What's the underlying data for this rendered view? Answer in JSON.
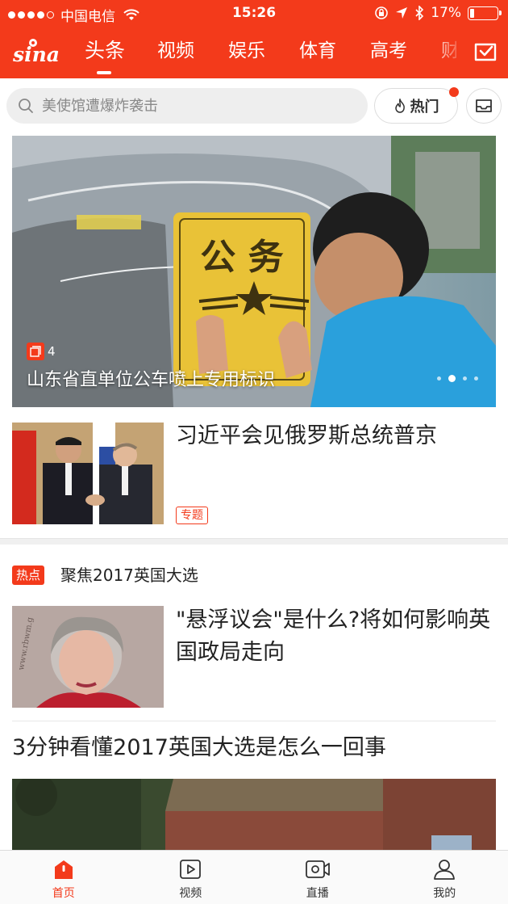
{
  "status_bar": {
    "carrier": "中国电信",
    "time": "15:26",
    "battery": "17%",
    "battery_level": 0.17
  },
  "header": {
    "logo_text": "sina",
    "tabs": [
      {
        "label": "头条",
        "active": true
      },
      {
        "label": "视频"
      },
      {
        "label": "娱乐"
      },
      {
        "label": "体育"
      },
      {
        "label": "高考"
      },
      {
        "label": "财经"
      }
    ]
  },
  "search": {
    "placeholder": "美使馆遭爆炸袭击",
    "hot_label": "热门"
  },
  "hero": {
    "caption": "山东省直单位公车喷上专用标识",
    "image_count": "4",
    "plate_text": "公 务",
    "pages": 4,
    "current_page": 2
  },
  "news": [
    {
      "title": "习近平会见俄罗斯总统普京",
      "tag": "专题"
    }
  ],
  "topic": {
    "label": "热点",
    "title": "聚焦2017英国大选"
  },
  "news2": {
    "title": "\"悬浮议会\"是什么?将如何影响英国政局走向",
    "watermark": "www.rbwm.g"
  },
  "news3": {
    "title": "3分钟看懂2017英国大选是怎么一回事"
  },
  "bottom_nav": [
    {
      "label": "首页",
      "icon": "home-icon",
      "active": true
    },
    {
      "label": "视频",
      "icon": "video-icon"
    },
    {
      "label": "直播",
      "icon": "live-camera-icon"
    },
    {
      "label": "我的",
      "icon": "person-icon"
    }
  ],
  "colors": {
    "brand": "#f33a1b",
    "text": "#222222"
  }
}
